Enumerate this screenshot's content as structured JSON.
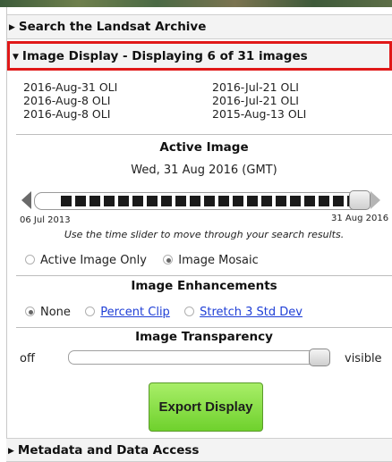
{
  "sections": {
    "search_title": "Search the Landsat Archive",
    "display_title": "Image Display - Displaying 6 of 31 images",
    "metadata_title": "Metadata and Data Access"
  },
  "images": {
    "col1": [
      "2016-Aug-31 OLI",
      "2016-Aug-8 OLI",
      "2016-Aug-8 OLI"
    ],
    "col2": [
      "2016-Jul-21 OLI",
      "2016-Jul-21 OLI",
      "2015-Aug-13 OLI"
    ]
  },
  "active_image": {
    "heading": "Active Image",
    "date": "Wed, 31 Aug 2016 (GMT)",
    "slider_start": "06 Jul 2013",
    "slider_end": "31 Aug 2016",
    "hint": "Use the time slider to move through your search results."
  },
  "mode": {
    "active_only": "Active Image Only",
    "mosaic": "Image Mosaic",
    "selected": "mosaic"
  },
  "enhancements": {
    "heading": "Image Enhancements",
    "none": "None",
    "percent_clip": "Percent Clip",
    "stretch": "Stretch 3 Std Dev",
    "selected": "none"
  },
  "transparency": {
    "heading": "Image Transparency",
    "off_label": "off",
    "visible_label": "visible",
    "level": 1.0
  },
  "export_label": "Export Display",
  "colors": {
    "highlight_border": "#e01818",
    "export_button": "#7ddc3a",
    "link": "#1f3fd6"
  }
}
